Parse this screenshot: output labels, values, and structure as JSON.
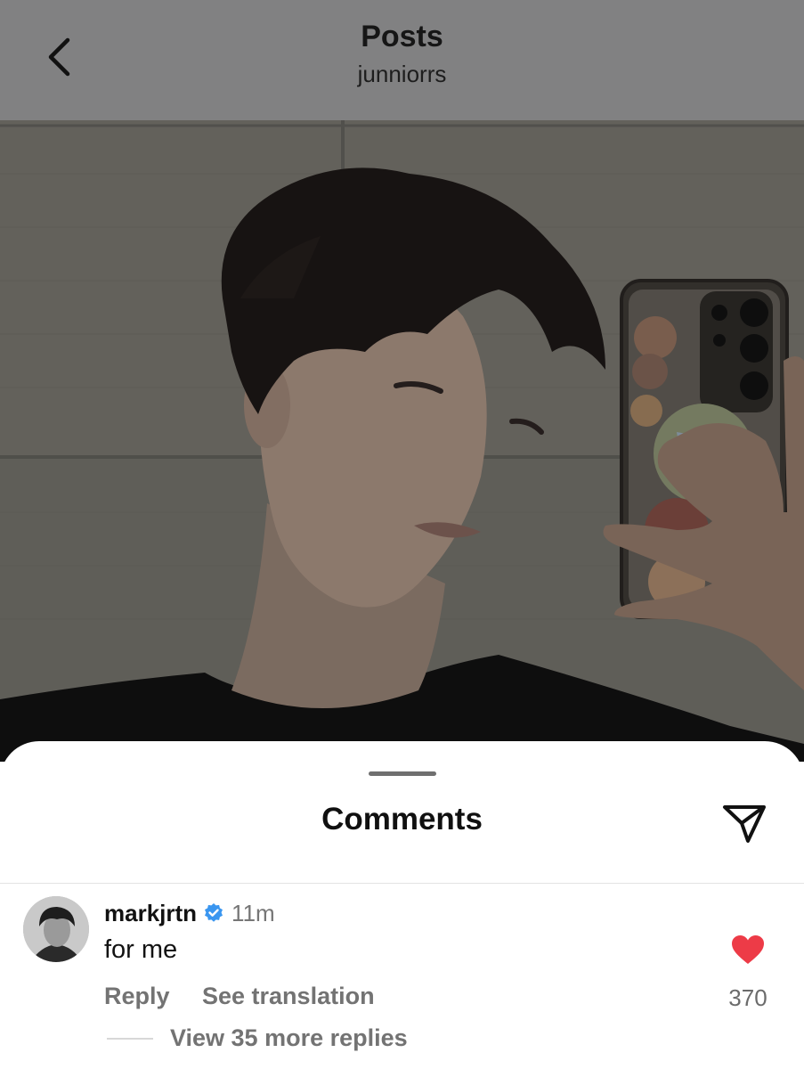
{
  "header": {
    "title": "Posts",
    "username": "junniorrs",
    "back_icon": "chevron-left-icon"
  },
  "comments_sheet": {
    "title": "Comments",
    "share_icon": "send-icon",
    "comments": [
      {
        "username": "markjrtn",
        "verified": true,
        "time": "11m",
        "text": "for me",
        "likes": "370",
        "liked": true,
        "reply_label": "Reply",
        "translate_label": "See translation",
        "view_replies_label": "View 35 more replies"
      }
    ]
  },
  "colors": {
    "dim_overlay": "#818182",
    "like_red": "#ed3b47",
    "verified_blue": "#3a96f0",
    "secondary_text": "#737373"
  }
}
